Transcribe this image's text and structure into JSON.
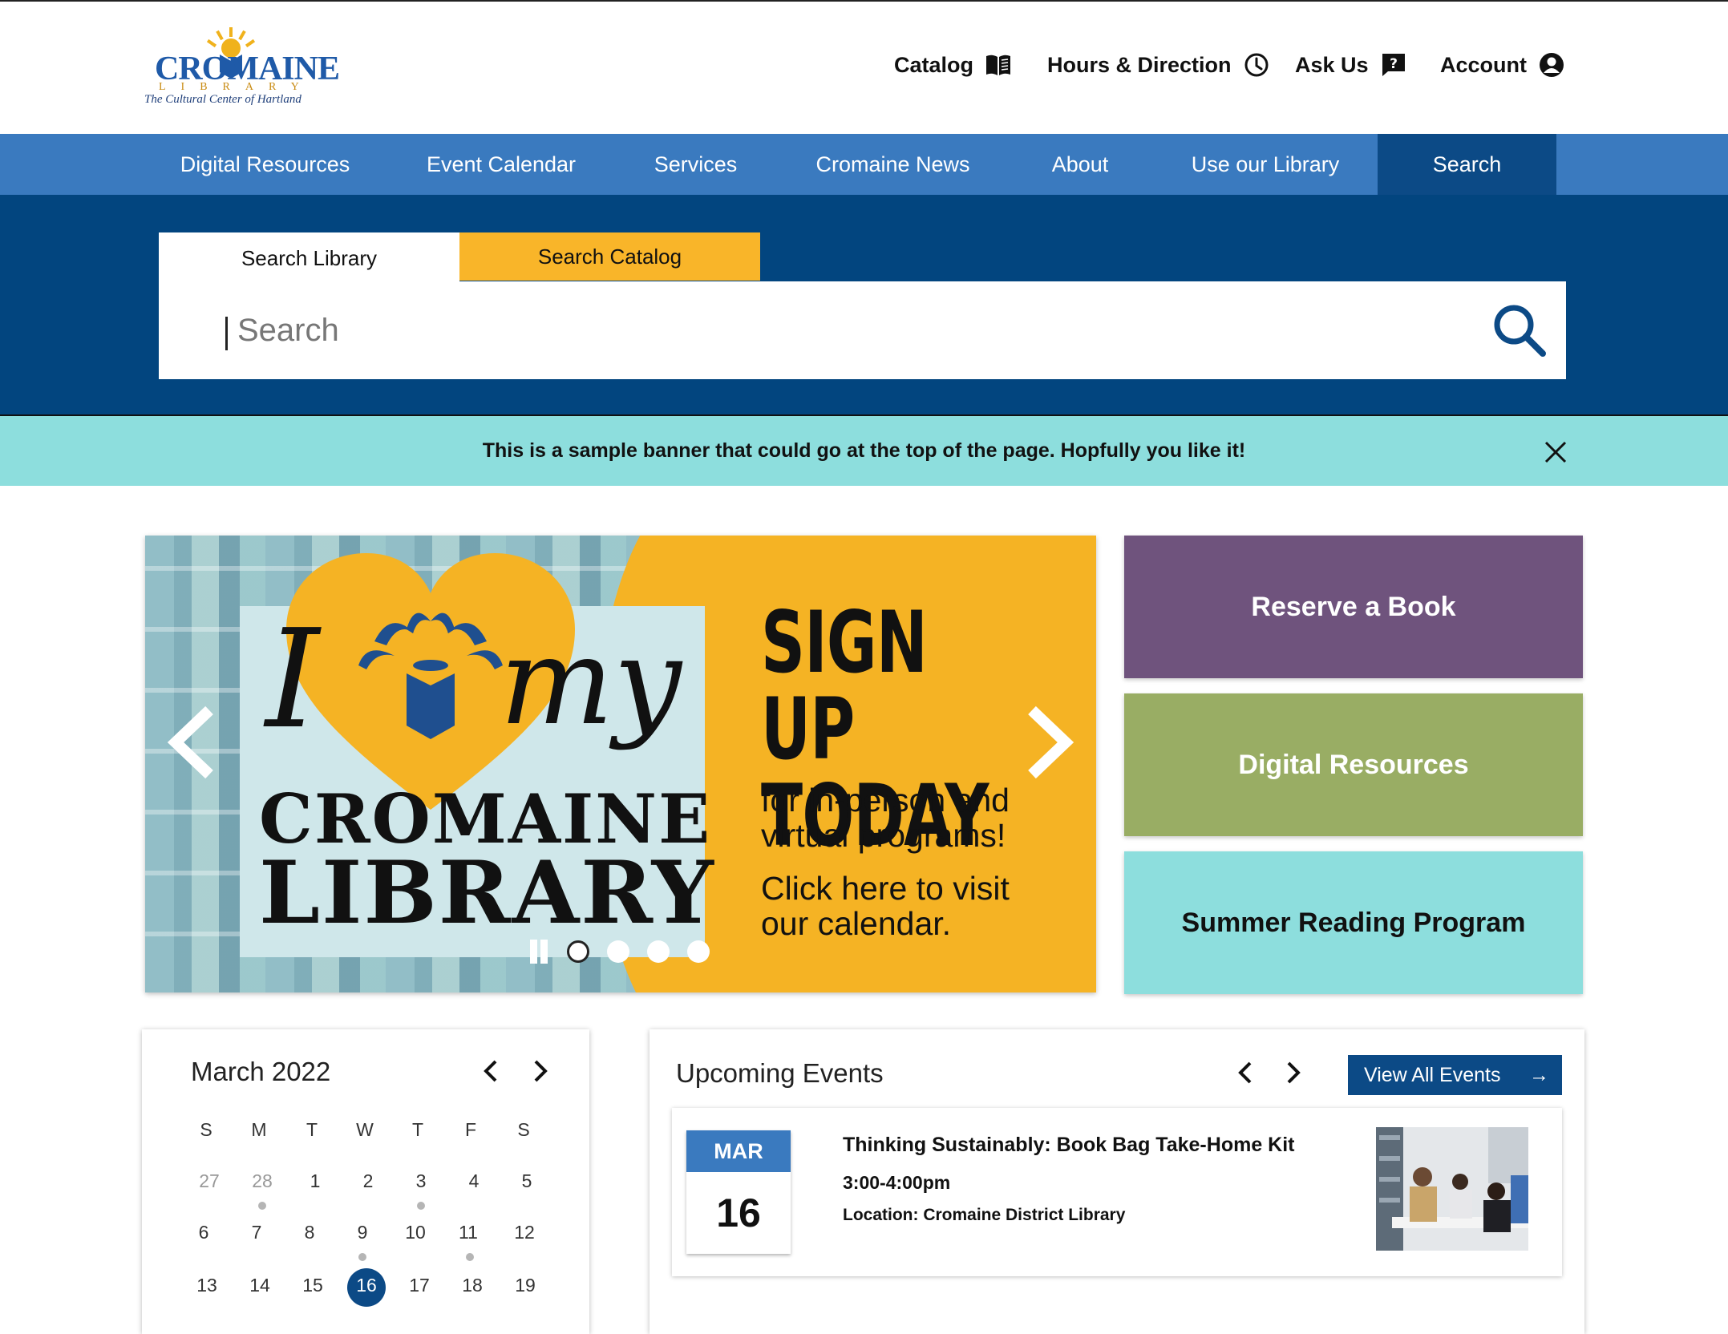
{
  "header": {
    "logo": {
      "name": "CROMAINE",
      "sub": "LIBRARY",
      "tagline": "The Cultural Center of Hartland"
    },
    "utility": [
      {
        "label": "Catalog",
        "icon": "book-icon"
      },
      {
        "label": "Hours & Direction",
        "icon": "clock-icon"
      },
      {
        "label": "Ask Us",
        "icon": "question-bubble-icon"
      },
      {
        "label": "Account",
        "icon": "account-icon"
      }
    ]
  },
  "nav": {
    "items": [
      "Digital Resources",
      "Event Calendar",
      "Services",
      "Cromaine News",
      "About",
      "Use our Library",
      "Search"
    ],
    "active": "Search"
  },
  "search": {
    "tabs": [
      "Search Library",
      "Search Catalog"
    ],
    "placeholder": "Search",
    "value": ""
  },
  "alert": {
    "text": "This is a sample banner that could go at the top of the page. Hopfully you like it!"
  },
  "carousel": {
    "slide": {
      "i_word": "I",
      "my_word": "my",
      "name_line1": "CROMAINE",
      "name_line2": "LIBRARY",
      "headline": "SIGN UP\nTODAY",
      "sub1": "for in-person and virtual programs!",
      "sub2": "Click here to visit our calendar."
    },
    "slide_count": 4,
    "active_index": 0
  },
  "quick_links": [
    {
      "label": "Reserve a Book",
      "color": "#6f537d"
    },
    {
      "label": "Digital Resources",
      "color": "#99ad64"
    },
    {
      "label": "Summer Reading Program",
      "color": "#8ddedd"
    }
  ],
  "calendar": {
    "title": "March 2022",
    "dow": [
      "S",
      "M",
      "T",
      "W",
      "T",
      "F",
      "S"
    ],
    "weeks": [
      [
        "27",
        "28",
        "1",
        "2",
        "3",
        "4",
        "5"
      ],
      [
        "6",
        "7",
        "8",
        "9",
        "10",
        "11",
        "12"
      ],
      [
        "13",
        "14",
        "15",
        "16",
        "17",
        "18",
        "19"
      ]
    ],
    "today": "16"
  },
  "events": {
    "title": "Upcoming Events",
    "view_all": "View All Events",
    "items": [
      {
        "month": "MAR",
        "day": "16",
        "name": "Thinking Sustainably: Book Bag Take-Home Kit",
        "time": "3:00-4:00pm",
        "location": "Location: Cromaine District Library"
      }
    ]
  },
  "colors": {
    "nav": "#3a7abf",
    "nav_active": "#0c4a86",
    "search_band": "#02457f",
    "accent_yellow": "#f9b529",
    "alert": "#8ddedd"
  }
}
